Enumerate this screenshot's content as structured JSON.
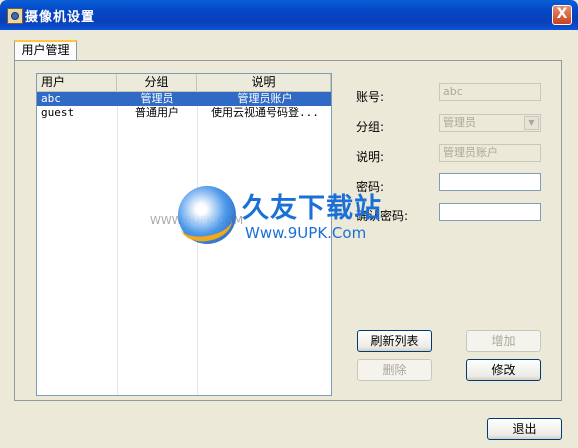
{
  "window": {
    "title": "摄像机设置",
    "close_glyph": "X"
  },
  "tabs": [
    {
      "label": "用户管理",
      "selected": true
    }
  ],
  "user_list": {
    "columns": [
      "用户",
      "分组",
      "说明"
    ],
    "rows": [
      {
        "user": "abc",
        "group": "管理员",
        "desc": "管理员账户",
        "selected": true
      },
      {
        "user": "guest",
        "group": "普通用户",
        "desc": "使用云视通号码登...",
        "selected": false
      }
    ]
  },
  "form": {
    "account_label": "账号:",
    "account_value": "abc",
    "group_label": "分组:",
    "group_value": "管理员",
    "desc_label": "说明:",
    "desc_value": "管理员账户",
    "password_label": "密码:",
    "password_value": "",
    "confirm_label": "确认密码:",
    "confirm_value": ""
  },
  "buttons": {
    "refresh": "刷新列表",
    "add": "增加",
    "delete": "删除",
    "modify": "修改",
    "exit": "退出"
  },
  "watermark": {
    "main": "久友下载站",
    "url": "Www.9UPK.Com",
    "small": "WWW.9UPK.COM"
  },
  "colors": {
    "titlebar": "#0a4fd0",
    "selection": "#316ac5",
    "face": "#ece9d8"
  }
}
